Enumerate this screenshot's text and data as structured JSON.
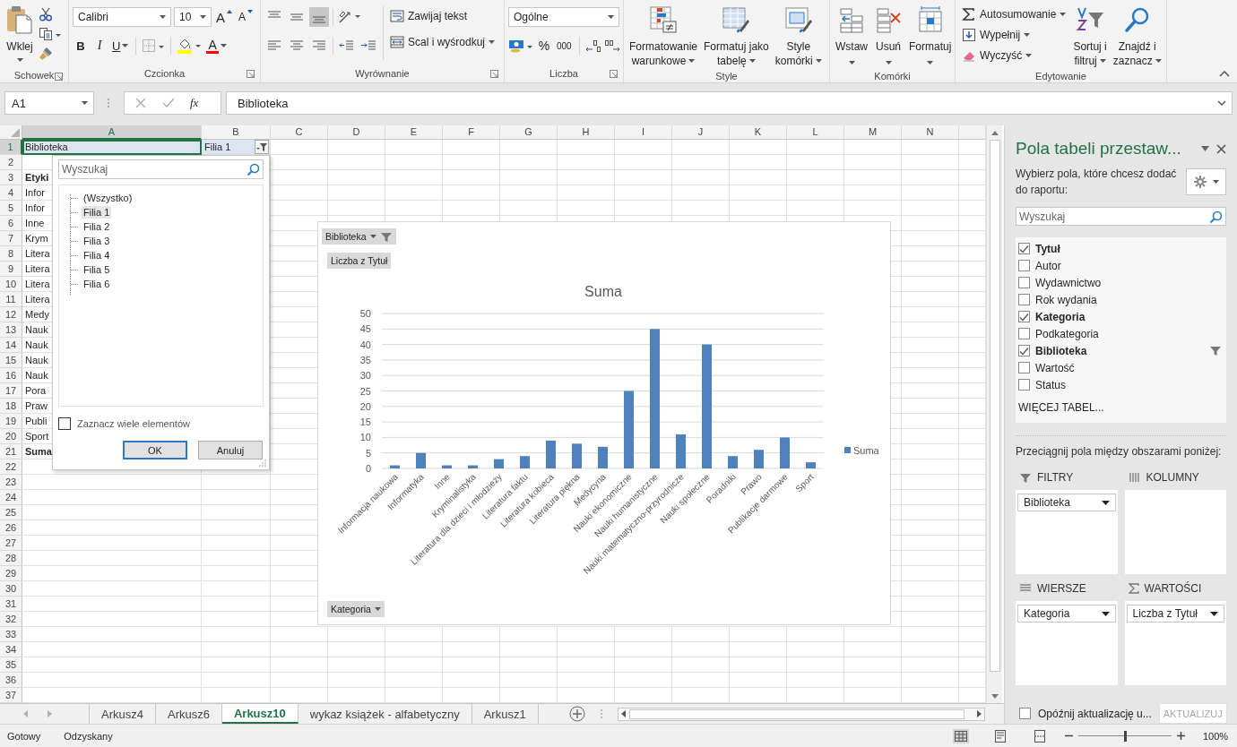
{
  "ribbon": {
    "clipboard": {
      "label": "Schowek",
      "paste": "Wklej"
    },
    "font": {
      "label": "Czcionka",
      "font_name": "Calibri",
      "font_size": "10",
      "grow": "A",
      "shrink": "A",
      "bold": "B",
      "italic": "I",
      "underline": "U",
      "font_color": "A"
    },
    "alignment": {
      "label": "Wyrównanie",
      "vertical": [
        {
          "kind": "top",
          "selected": false
        },
        {
          "kind": "middle",
          "selected": false
        },
        {
          "kind": "bottom",
          "selected": true
        }
      ],
      "wrap": "Zawijaj tekst",
      "merge": "Scal i wyśrodkuj"
    },
    "number": {
      "label": "Liczba",
      "format": "Ogólne",
      "percent": "%",
      "thousands": "000"
    },
    "styles": {
      "label": "Style",
      "buttons": [
        {
          "kind": "conditional",
          "lines": [
            "Formatowanie",
            "warunkowe"
          ]
        },
        {
          "kind": "table",
          "lines": [
            "Formatuj jako",
            "tabelę"
          ]
        },
        {
          "kind": "cell",
          "lines": [
            "Style",
            "komórki"
          ]
        }
      ]
    },
    "cells": {
      "label": "Komórki",
      "buttons": [
        {
          "kind": "insert",
          "label": "Wstaw"
        },
        {
          "kind": "delete",
          "label": "Usuń"
        },
        {
          "kind": "format",
          "label": "Formatuj"
        }
      ]
    },
    "editing": {
      "label": "Edytowanie",
      "small": [
        {
          "kind": "autosum",
          "label": "Autosumowanie"
        },
        {
          "kind": "fill",
          "label": "Wypełnij"
        },
        {
          "kind": "clear",
          "label": "Wyczyść"
        }
      ],
      "large": [
        {
          "kind": "sort",
          "lines": [
            "Sortuj i",
            "filtruj"
          ]
        },
        {
          "kind": "find",
          "lines": [
            "Znajdź i",
            "zaznacz"
          ]
        }
      ]
    }
  },
  "formula_bar": {
    "name_box": "A1",
    "fx": "fx",
    "value": "Biblioteka"
  },
  "sheet": {
    "columns": [
      {
        "label": "A",
        "selected": true
      },
      {
        "label": "B",
        "selected": false
      },
      {
        "label": "C",
        "selected": false
      },
      {
        "label": "D",
        "selected": false
      },
      {
        "label": "E",
        "selected": false
      },
      {
        "label": "F",
        "selected": false
      },
      {
        "label": "G",
        "selected": false
      },
      {
        "label": "H",
        "selected": false
      },
      {
        "label": "I",
        "selected": false
      },
      {
        "label": "J",
        "selected": false
      },
      {
        "label": "K",
        "selected": false
      },
      {
        "label": "L",
        "selected": false
      },
      {
        "label": "M",
        "selected": false
      },
      {
        "label": "N",
        "selected": false
      }
    ],
    "rows": [
      {
        "number": "1",
        "selected": true,
        "kind": "filter",
        "cells": [
          "Biblioteka",
          "Filia 1"
        ]
      },
      {
        "number": "2",
        "selected": false,
        "kind": "plain"
      },
      {
        "number": "3",
        "selected": false,
        "kind": "header",
        "cells": [
          "Etyki"
        ]
      },
      {
        "number": "4",
        "selected": false,
        "kind": "plain",
        "cells": [
          "Infor"
        ]
      },
      {
        "number": "5",
        "selected": false,
        "kind": "plain",
        "cells": [
          "Infor"
        ]
      },
      {
        "number": "6",
        "selected": false,
        "kind": "plain",
        "cells": [
          "Inne"
        ]
      },
      {
        "number": "7",
        "selected": false,
        "kind": "plain",
        "cells": [
          "Krym"
        ]
      },
      {
        "number": "8",
        "selected": false,
        "kind": "plain",
        "cells": [
          "Litera"
        ]
      },
      {
        "number": "9",
        "selected": false,
        "kind": "plain",
        "cells": [
          "Litera"
        ]
      },
      {
        "number": "10",
        "selected": false,
        "kind": "plain",
        "cells": [
          "Litera"
        ]
      },
      {
        "number": "11",
        "selected": false,
        "kind": "plain",
        "cells": [
          "Litera"
        ]
      },
      {
        "number": "12",
        "selected": false,
        "kind": "plain",
        "cells": [
          "Medy"
        ]
      },
      {
        "number": "13",
        "selected": false,
        "kind": "plain",
        "cells": [
          "Nauk"
        ]
      },
      {
        "number": "14",
        "selected": false,
        "kind": "plain",
        "cells": [
          "Nauk"
        ]
      },
      {
        "number": "15",
        "selected": false,
        "kind": "plain",
        "cells": [
          "Nauk"
        ]
      },
      {
        "number": "16",
        "selected": false,
        "kind": "plain",
        "cells": [
          "Nauk"
        ]
      },
      {
        "number": "17",
        "selected": false,
        "kind": "plain",
        "cells": [
          "Pora"
        ]
      },
      {
        "number": "18",
        "selected": false,
        "kind": "plain",
        "cells": [
          "Praw"
        ]
      },
      {
        "number": "19",
        "selected": false,
        "kind": "plain",
        "cells": [
          "Publi"
        ]
      },
      {
        "number": "20",
        "selected": false,
        "kind": "plain",
        "cells": [
          "Sport"
        ]
      },
      {
        "number": "21",
        "selected": false,
        "kind": "header",
        "cells": [
          "Suma"
        ]
      },
      {
        "number": "22",
        "selected": false,
        "kind": "plain"
      },
      {
        "number": "23",
        "selected": false,
        "kind": "plain"
      },
      {
        "number": "24",
        "selected": false,
        "kind": "plain"
      },
      {
        "number": "25",
        "selected": false,
        "kind": "plain"
      },
      {
        "number": "26",
        "selected": false,
        "kind": "plain"
      },
      {
        "number": "27",
        "selected": false,
        "kind": "plain"
      },
      {
        "number": "28",
        "selected": false,
        "kind": "plain"
      },
      {
        "number": "29",
        "selected": false,
        "kind": "plain"
      },
      {
        "number": "30",
        "selected": false,
        "kind": "plain"
      },
      {
        "number": "31",
        "selected": false,
        "kind": "plain"
      },
      {
        "number": "32",
        "selected": false,
        "kind": "plain"
      },
      {
        "number": "33",
        "selected": false,
        "kind": "plain"
      },
      {
        "number": "34",
        "selected": false,
        "kind": "plain"
      },
      {
        "number": "35",
        "selected": false,
        "kind": "plain"
      },
      {
        "number": "36",
        "selected": false,
        "kind": "plain"
      },
      {
        "number": "37",
        "selected": false,
        "kind": "plain"
      }
    ]
  },
  "filter_dropdown": {
    "search_placeholder": "Wyszukaj",
    "items": [
      {
        "label": "(Wszystko)",
        "selected": false
      },
      {
        "label": "Filia 1",
        "selected": true
      },
      {
        "label": "Filia 2",
        "selected": false
      },
      {
        "label": "Filia 3",
        "selected": false
      },
      {
        "label": "Filia 4",
        "selected": false
      },
      {
        "label": "Filia 5",
        "selected": false
      },
      {
        "label": "Filia 6",
        "selected": false
      }
    ],
    "multi_select": {
      "label": "Zaznacz wiele elementów",
      "checked": false
    },
    "buttons": [
      {
        "label": "OK",
        "default": true
      },
      {
        "label": "Anuluj",
        "default": false
      }
    ]
  },
  "pivot_chart": {
    "filter_button": "Biblioteka",
    "value_button": "Liczba z Tytuł",
    "axis_button": "Kategoria",
    "chart_data": {
      "type": "bar",
      "title": "Suma",
      "categories": [
        "Informacja naukowa",
        "Informatyka",
        "Inne",
        "Kryminalistyka",
        "Literatura dla dzieci i młodzieży",
        "Literatura faktu",
        "Literatura kobieca",
        "Literatura piękna",
        "Medycyna",
        "Nauki ekonomiczne",
        "Nauki humanistyczne",
        "Nauki matematyczno-przyrodnicze",
        "Nauki społeczne",
        "Poradniki",
        "Prawo",
        "Publikacje darmowe",
        "Sport"
      ],
      "series": [
        {
          "name": "Suma",
          "color": "#4f81bd",
          "values": [
            1,
            5,
            1,
            1,
            3,
            4,
            9,
            8,
            7,
            25,
            45,
            11,
            40,
            4,
            6,
            10,
            2
          ]
        }
      ],
      "grid": true,
      "ylim": [
        0,
        50
      ],
      "yticks": [
        0,
        5,
        10,
        15,
        20,
        25,
        30,
        35,
        40,
        45,
        50
      ]
    }
  },
  "pivot_panel": {
    "title": "Pola tabeli przestaw...",
    "subtitle": "Wybierz pola, które chcesz dodać do raportu:",
    "search_placeholder": "Wyszukaj",
    "fields": [
      {
        "label": "Tytuł",
        "checked": true,
        "filtered": false
      },
      {
        "label": "Autor",
        "checked": false,
        "filtered": false
      },
      {
        "label": "Wydawnictwo",
        "checked": false,
        "filtered": false
      },
      {
        "label": "Rok wydania",
        "checked": false,
        "filtered": false
      },
      {
        "label": "Kategoria",
        "checked": true,
        "filtered": false
      },
      {
        "label": "Podkategoria",
        "checked": false,
        "filtered": false
      },
      {
        "label": "Biblioteka",
        "checked": true,
        "filtered": true
      },
      {
        "label": "Wartość",
        "checked": false,
        "filtered": false
      },
      {
        "label": "Status",
        "checked": false,
        "filtered": false
      }
    ],
    "more_tables": "WIĘCEJ TABEL...",
    "drag_hint": "Przeciągnij pola między obszarami poniżej:",
    "areas": [
      {
        "kind": "filters",
        "label": "FILTRY",
        "items": [
          "Biblioteka"
        ]
      },
      {
        "kind": "columns",
        "label": "KOLUMNY"
      },
      {
        "kind": "rows",
        "label": "WIERSZE",
        "items": [
          "Kategoria"
        ]
      },
      {
        "kind": "values",
        "label": "WARTOŚCI",
        "items": [
          "Liczba z Tytuł"
        ]
      }
    ],
    "defer": {
      "label": "Opóźnij aktualizację u...",
      "checked": false
    },
    "update_button": {
      "label": "AKTUALIZUJ",
      "disabled": true
    }
  },
  "sheet_tabs": [
    {
      "label": "Arkusz4",
      "selected": false
    },
    {
      "label": "Arkusz6",
      "selected": false
    },
    {
      "label": "Arkusz10",
      "selected": true
    },
    {
      "label": "wykaz książek - alfabetyczny",
      "selected": false
    },
    {
      "label": "Arkusz1",
      "selected": false
    }
  ],
  "status_bar": {
    "items": [
      "Gotowy",
      "Odzyskany"
    ],
    "views": [
      {
        "kind": "normal",
        "selected": true
      },
      {
        "kind": "layout",
        "selected": false
      },
      {
        "kind": "break",
        "selected": false
      }
    ],
    "zoom": {
      "level": 0.5,
      "reading": "100%"
    }
  }
}
